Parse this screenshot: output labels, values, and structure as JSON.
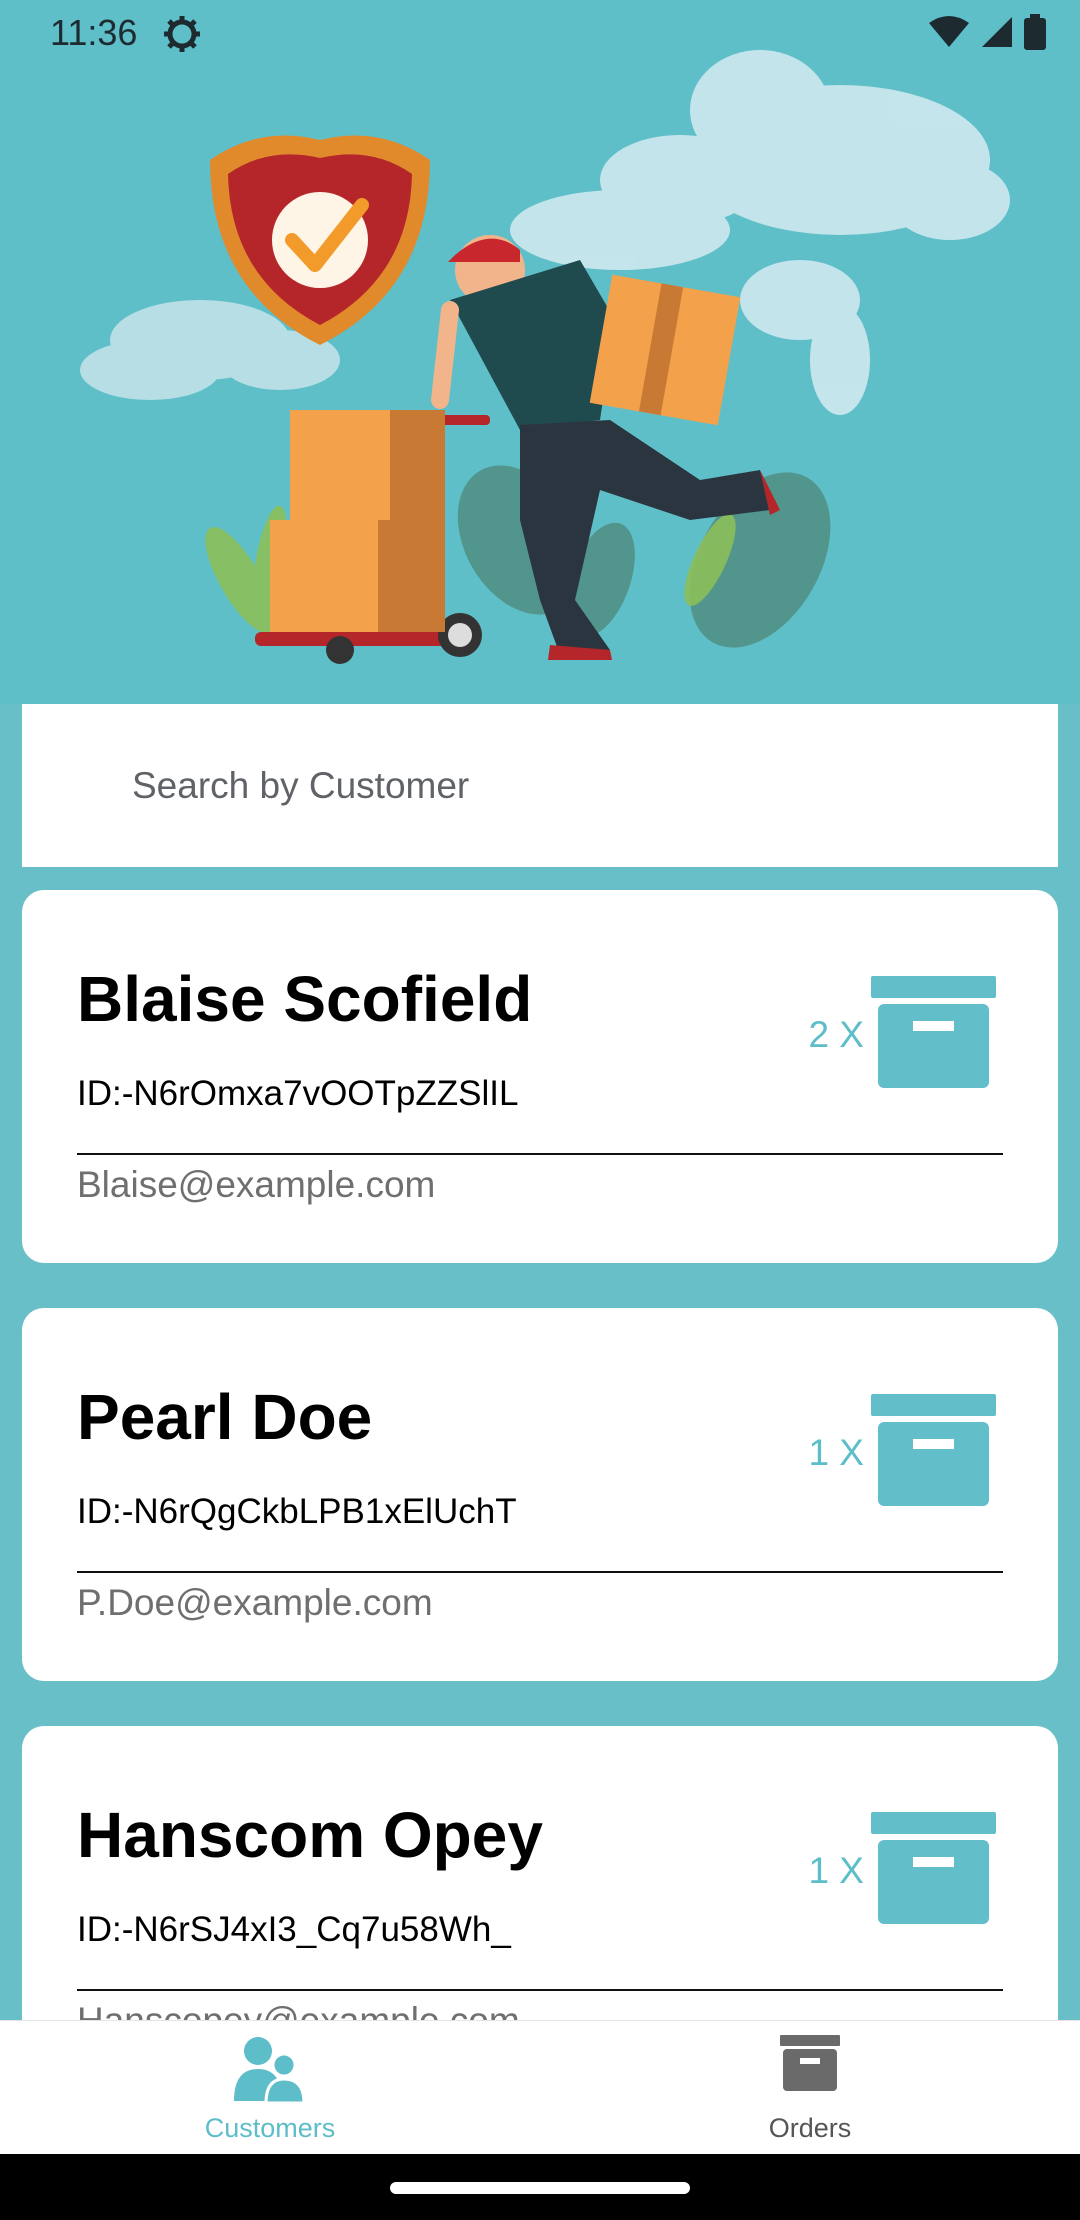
{
  "status_bar": {
    "time": "11:36",
    "icons": [
      "settings-icon",
      "wifi-icon",
      "signal-icon",
      "battery-icon"
    ]
  },
  "search": {
    "placeholder": "Search by Customer",
    "value": ""
  },
  "customers": [
    {
      "name": "Blaise Scofield",
      "id": "ID:-N6rOmxa7vOOTpZZSlIL",
      "email": "Blaise@example.com",
      "count": "2 X"
    },
    {
      "name": "Pearl Doe",
      "id": "ID:-N6rQgCkbLPB1xElUchT",
      "email": "P.Doe@example.com",
      "count": "1 X"
    },
    {
      "name": "Hanscom Opey",
      "id": "ID:-N6rSJ4xI3_Cq7u58Wh_",
      "email": "Hanscopey@example.com",
      "count": "1 X"
    }
  ],
  "bottom_nav": {
    "customers_label": "Customers",
    "orders_label": "Orders"
  },
  "colors": {
    "accent": "#5dbdc8",
    "background": "#68bfc8",
    "hero": "#5ebfc9"
  }
}
